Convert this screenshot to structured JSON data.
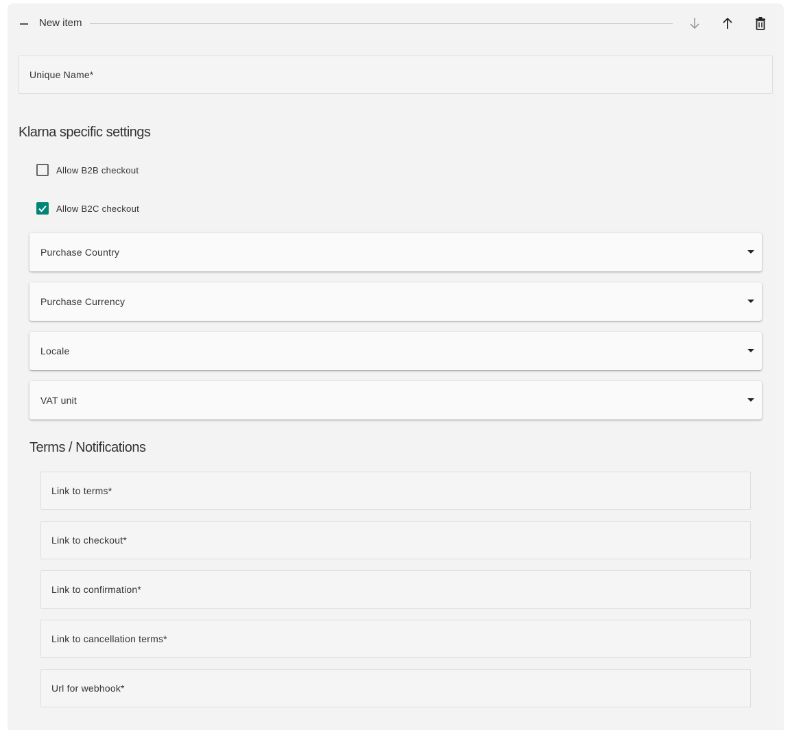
{
  "header": {
    "title": "New item",
    "collapse_icon": "minus-icon",
    "move_down_icon": "arrow-down-icon",
    "move_up_icon": "arrow-up-icon",
    "delete_icon": "trash-icon"
  },
  "fields": {
    "unique_name": {
      "label": "Unique Name*",
      "value": ""
    }
  },
  "klarna": {
    "section_title": "Klarna specific settings",
    "checkboxes": [
      {
        "label": "Allow B2B checkout",
        "checked": false
      },
      {
        "label": "Allow B2C checkout",
        "checked": true
      }
    ],
    "selects": [
      {
        "label": "Purchase Country",
        "value": ""
      },
      {
        "label": "Purchase Currency",
        "value": ""
      },
      {
        "label": "Locale",
        "value": ""
      },
      {
        "label": "VAT unit",
        "value": ""
      }
    ]
  },
  "terms": {
    "section_title": "Terms / Notifications",
    "fields": [
      {
        "label": "Link to terms*",
        "value": ""
      },
      {
        "label": "Link to checkout*",
        "value": ""
      },
      {
        "label": "Link to confirmation*",
        "value": ""
      },
      {
        "label": "Link to cancellation terms*",
        "value": ""
      },
      {
        "label": "Url for webhook*",
        "value": ""
      }
    ]
  },
  "colors": {
    "accent": "#008577",
    "panel_background": "#f3f3f3",
    "field_background": "#f5f5f5"
  }
}
